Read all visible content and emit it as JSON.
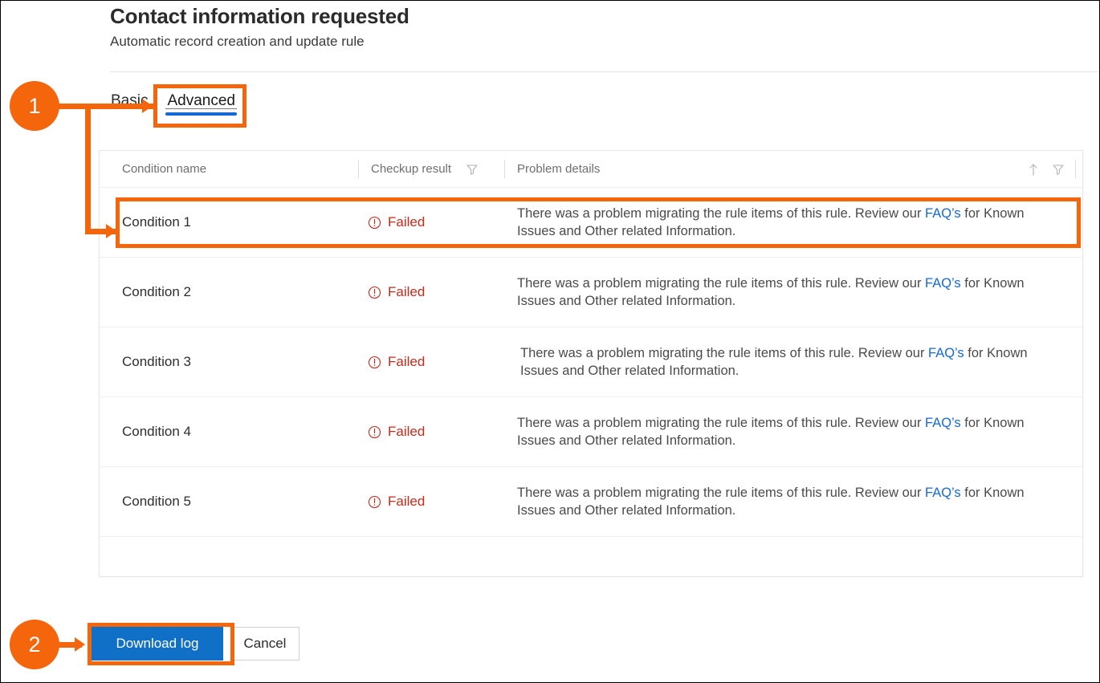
{
  "header": {
    "title": "Contact information requested",
    "subtitle": "Automatic record creation and update rule"
  },
  "tabs": [
    {
      "label": "Basic",
      "active": false
    },
    {
      "label": "Advanced",
      "active": true
    }
  ],
  "table": {
    "columns": {
      "condition_name": "Condition name",
      "checkup_result": "Checkup result",
      "problem_details": "Problem details"
    },
    "icons": {
      "checkup_filter": "filter-icon",
      "sort_ascending": "sort-ascending-arrow-icon",
      "details_filter": "filter-icon"
    },
    "rows": [
      {
        "condition": "Condition 1",
        "status": "Failed",
        "status_icon": "error-circle-icon",
        "details_before_link": "There was a problem migrating the rule items of this rule. Review our ",
        "details_link": "FAQ’s",
        "details_after_link": " for Known Issues and Other related Information."
      },
      {
        "condition": "Condition 2",
        "status": "Failed",
        "status_icon": "error-circle-icon",
        "details_before_link": "There was a problem migrating the rule items of this rule. Review our ",
        "details_link": "FAQ’s",
        "details_after_link": " for Known Issues and Other related Information."
      },
      {
        "condition": "Condition 3",
        "status": "Failed",
        "status_icon": "error-circle-icon",
        "details_before_link": "There was a problem migrating the rule items of this rule. Review our ",
        "details_link": "FAQ’s",
        "details_after_link": " for Known Issues and Other related Information."
      },
      {
        "condition": "Condition 4",
        "status": "Failed",
        "status_icon": "error-circle-icon",
        "details_before_link": "There was a problem migrating the rule items of this rule. Review our ",
        "details_link": "FAQ’s",
        "details_after_link": " for Known Issues and Other related Information."
      },
      {
        "condition": "Condition 5",
        "status": "Failed",
        "status_icon": "error-circle-icon",
        "details_before_link": "There was a problem migrating the rule items of this rule. Review our ",
        "details_link": "FAQ’s",
        "details_after_link": " for Known Issues and Other related Information."
      }
    ]
  },
  "footer": {
    "download_log_label": "Download log",
    "cancel_label": "Cancel"
  },
  "annotations": [
    {
      "number": "1",
      "targets": "advanced-tab and condition-1-row"
    },
    {
      "number": "2",
      "targets": "download-log-button"
    }
  ],
  "colors": {
    "annotation_orange": "#F4650C",
    "primary_blue": "#1070C8",
    "tab_underline_blue": "#1668D6",
    "link_blue": "#1668D6",
    "error_red": "#C42B1C"
  }
}
